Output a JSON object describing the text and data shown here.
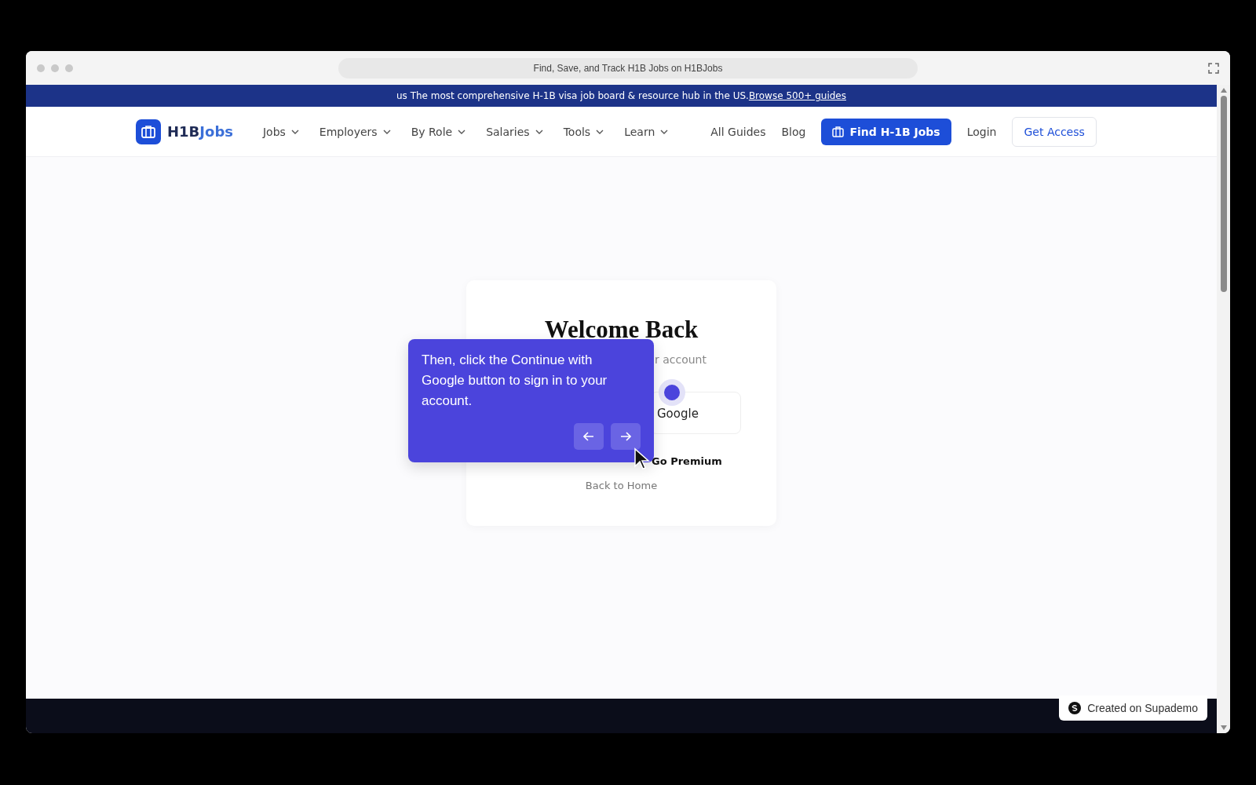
{
  "window": {
    "title": "Find, Save, and Track H1B Jobs on H1BJobs"
  },
  "banner": {
    "text": "us The most comprehensive H-1B visa job board & resource hub in the US.",
    "link": "Browse 500+ guides"
  },
  "nav": {
    "logo": {
      "text_dark": "H1B",
      "text_accent": "Jobs"
    },
    "menus": [
      {
        "label": "Jobs"
      },
      {
        "label": "Employers"
      },
      {
        "label": "By Role"
      },
      {
        "label": "Salaries"
      },
      {
        "label": "Tools"
      },
      {
        "label": "Learn"
      }
    ],
    "links": [
      {
        "label": "All Guides"
      },
      {
        "label": "Blog"
      }
    ],
    "primary_button": "Find H-1B Jobs",
    "login": "Login",
    "cta": "Get Access"
  },
  "login_card": {
    "title": "Welcome Back",
    "subtitle": "r account",
    "google_button": "Google",
    "premium_link": "Go Premium",
    "back_link": "Back to Home"
  },
  "tooltip": {
    "text": "Then, click the Continue with Google button to sign in to your account."
  },
  "badge": {
    "text": "Created on Supademo"
  }
}
